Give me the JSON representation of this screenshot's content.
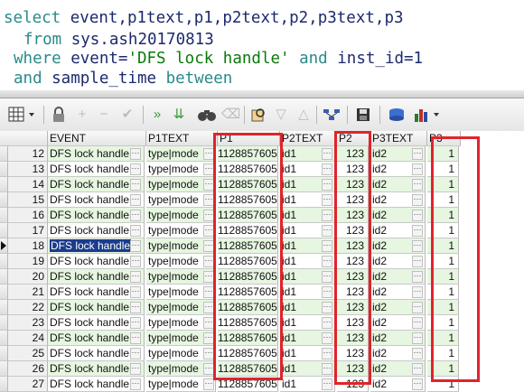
{
  "sql": {
    "line1": {
      "kw": "select",
      "rest": " event,p1text,p1,p2text,p2,p3text,p3"
    },
    "line2": {
      "kw": "from",
      "rest": " sys.ash20170813"
    },
    "line3": {
      "kw": "where",
      "rest1": " event=",
      "str": "'DFS lock handle'",
      "kw2": " and",
      "rest2": " inst_id=1"
    },
    "line4": {
      "kw": "and",
      "rest": " sample_time ",
      "kw2": "between"
    }
  },
  "toolbar": {
    "icons": [
      "grid-options-icon",
      "lock-icon",
      "add-record-icon",
      "delete-record-icon",
      "post-changes-icon",
      "next-page-icon",
      "last-page-icon",
      "find-icon",
      "clear-icon",
      "query-by-example-icon",
      "filter-down-icon",
      "filter-up-icon",
      "link-icon",
      "save-icon",
      "export-icon",
      "chart-icon"
    ]
  },
  "grid": {
    "columns": [
      "EVENT",
      "P1TEXT",
      "P1",
      "P2TEXT",
      "P2",
      "P3TEXT",
      "P3"
    ],
    "rows": [
      {
        "n": "12",
        "event": "DFS lock handle",
        "p1text": "type|mode",
        "p1": "1128857605",
        "p2text": "id1",
        "p2": "123",
        "p3text": "id2",
        "p3": "1"
      },
      {
        "n": "13",
        "event": "DFS lock handle",
        "p1text": "type|mode",
        "p1": "1128857605",
        "p2text": "id1",
        "p2": "123",
        "p3text": "id2",
        "p3": "1"
      },
      {
        "n": "14",
        "event": "DFS lock handle",
        "p1text": "type|mode",
        "p1": "1128857605",
        "p2text": "id1",
        "p2": "123",
        "p3text": "id2",
        "p3": "1"
      },
      {
        "n": "15",
        "event": "DFS lock handle",
        "p1text": "type|mode",
        "p1": "1128857605",
        "p2text": "id1",
        "p2": "123",
        "p3text": "id2",
        "p3": "1"
      },
      {
        "n": "16",
        "event": "DFS lock handle",
        "p1text": "type|mode",
        "p1": "1128857605",
        "p2text": "id1",
        "p2": "123",
        "p3text": "id2",
        "p3": "1"
      },
      {
        "n": "17",
        "event": "DFS lock handle",
        "p1text": "type|mode",
        "p1": "1128857605",
        "p2text": "id1",
        "p2": "123",
        "p3text": "id2",
        "p3": "1"
      },
      {
        "n": "18",
        "event": "DFS lock handle",
        "p1text": "type|mode",
        "p1": "1128857605",
        "p2text": "id1",
        "p2": "123",
        "p3text": "id2",
        "p3": "1",
        "selected": true
      },
      {
        "n": "19",
        "event": "DFS lock handle",
        "p1text": "type|mode",
        "p1": "1128857605",
        "p2text": "id1",
        "p2": "123",
        "p3text": "id2",
        "p3": "1"
      },
      {
        "n": "20",
        "event": "DFS lock handle",
        "p1text": "type|mode",
        "p1": "1128857605",
        "p2text": "id1",
        "p2": "123",
        "p3text": "id2",
        "p3": "1"
      },
      {
        "n": "21",
        "event": "DFS lock handle",
        "p1text": "type|mode",
        "p1": "1128857605",
        "p2text": "id1",
        "p2": "123",
        "p3text": "id2",
        "p3": "1"
      },
      {
        "n": "22",
        "event": "DFS lock handle",
        "p1text": "type|mode",
        "p1": "1128857605",
        "p2text": "id1",
        "p2": "123",
        "p3text": "id2",
        "p3": "1"
      },
      {
        "n": "23",
        "event": "DFS lock handle",
        "p1text": "type|mode",
        "p1": "1128857605",
        "p2text": "id1",
        "p2": "123",
        "p3text": "id2",
        "p3": "1"
      },
      {
        "n": "24",
        "event": "DFS lock handle",
        "p1text": "type|mode",
        "p1": "1128857605",
        "p2text": "id1",
        "p2": "123",
        "p3text": "id2",
        "p3": "1"
      },
      {
        "n": "25",
        "event": "DFS lock handle",
        "p1text": "type|mode",
        "p1": "1128857605",
        "p2text": "id1",
        "p2": "123",
        "p3text": "id2",
        "p3": "1"
      },
      {
        "n": "26",
        "event": "DFS lock handle",
        "p1text": "type|mode",
        "p1": "1128857605",
        "p2text": "id1",
        "p2": "123",
        "p3text": "id2",
        "p3": "1"
      },
      {
        "n": "27",
        "event": "DFS lock handle",
        "p1text": "type|mode",
        "p1": "1128857605",
        "p2text": "id1",
        "p2": "123",
        "p3text": "id2",
        "p3": "1"
      }
    ]
  },
  "colors": {
    "highlight": "#e0242a",
    "selection": "#1a3c8c",
    "alt_row": "#e6f6e0"
  }
}
